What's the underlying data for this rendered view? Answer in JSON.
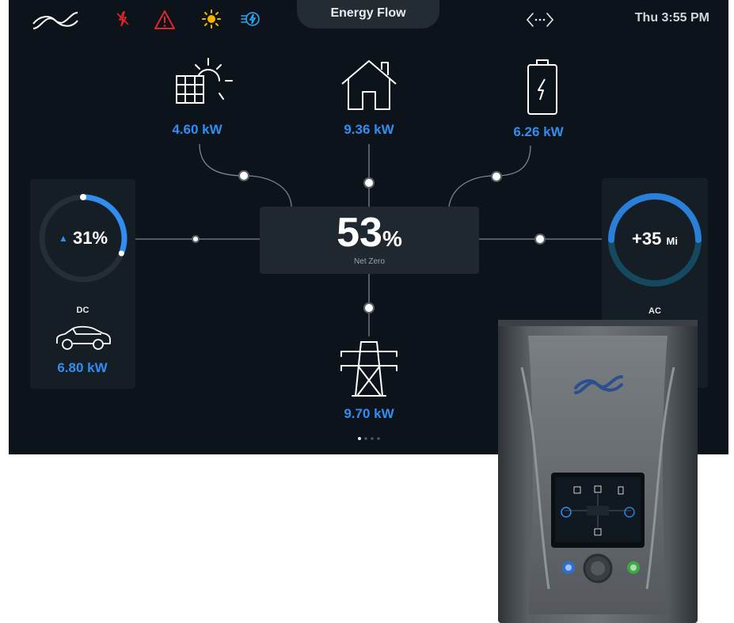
{
  "status_bar": {
    "title": "Energy Flow",
    "time": "Thu 3:55 PM",
    "icons": [
      "logo-icon",
      "grid-fault-icon",
      "warning-icon",
      "sun-icon",
      "charging-icon",
      "network-icon"
    ]
  },
  "flow": {
    "solar": {
      "value": "4.60 kW",
      "icon": "solar-panel-icon"
    },
    "home": {
      "value": "9.36 kW",
      "icon": "home-icon"
    },
    "battery": {
      "value": "6.26 kW",
      "icon": "battery-icon"
    },
    "grid": {
      "value": "9.70 kW",
      "icon": "grid-tower-icon"
    },
    "center": {
      "percent": "53",
      "unit": "%",
      "label": "Net Zero"
    }
  },
  "dc_panel": {
    "gauge_text": "31%",
    "gauge_level": 0.31,
    "label": "DC",
    "value": "6.80 kW",
    "icon": "car-icon"
  },
  "ac_panel": {
    "gauge_text": "+35",
    "gauge_unit": "Mi",
    "label": "AC"
  },
  "pager": {
    "count": 4,
    "active": 0
  },
  "colors": {
    "accent": "#2f8ef0",
    "background": "#0c131a",
    "panel": "#151d25",
    "warning": "#e0262b",
    "sun": "#f4b400"
  }
}
